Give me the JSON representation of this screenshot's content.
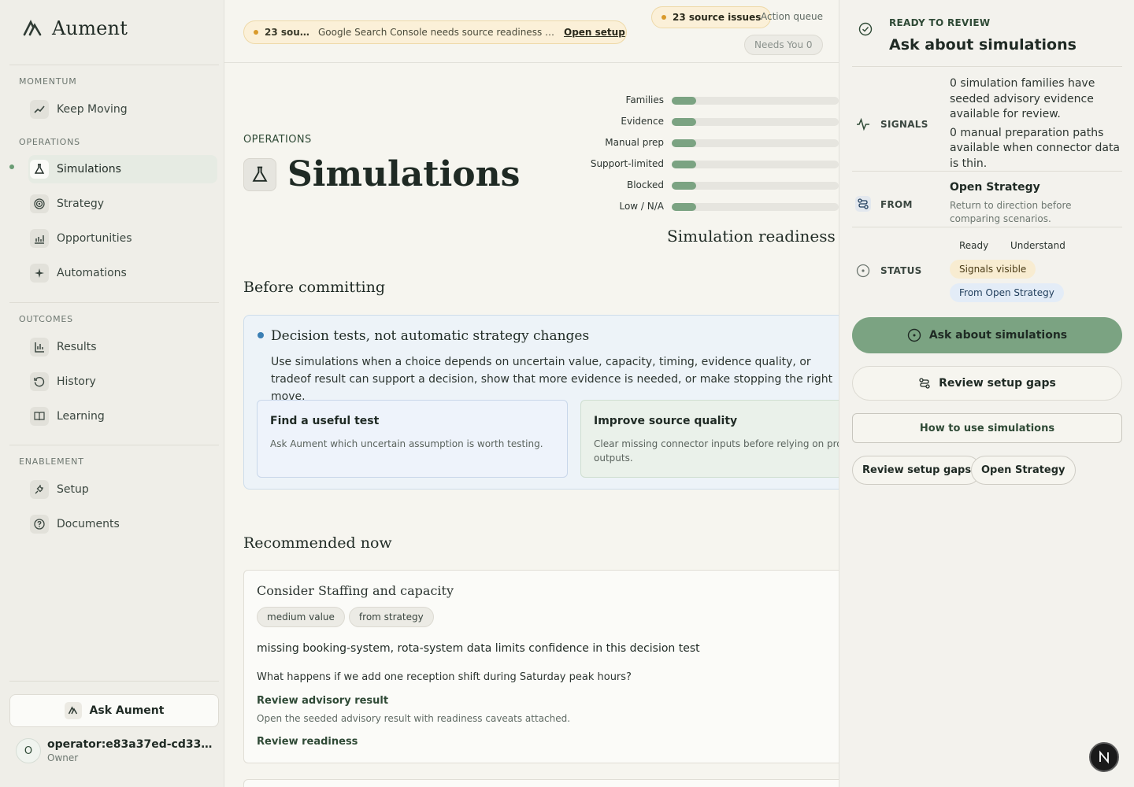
{
  "brand": {
    "name": "Aument"
  },
  "sidebar": {
    "sections": [
      "MOMENTUM",
      "OPERATIONS",
      "OUTCOMES",
      "ENABLEMENT"
    ],
    "items": [
      {
        "label": "Keep Moving",
        "icon": "trend-up-icon"
      },
      {
        "label": "Simulations",
        "icon": "flask-icon"
      },
      {
        "label": "Strategy",
        "icon": "target-icon"
      },
      {
        "label": "Opportunities",
        "icon": "chart-icon"
      },
      {
        "label": "Automations",
        "icon": "sparkle-icon"
      },
      {
        "label": "Results",
        "icon": "bars-icon"
      },
      {
        "label": "History",
        "icon": "history-icon"
      },
      {
        "label": "Learning",
        "icon": "book-icon"
      },
      {
        "label": "Setup",
        "icon": "plug-icon"
      },
      {
        "label": "Documents",
        "icon": "help-icon"
      }
    ],
    "ask_label": "Ask Aument",
    "user": {
      "initial": "O",
      "name": "operator:e83a37ed-cd33-41...",
      "role": "Owner"
    }
  },
  "topbar": {
    "alert_count": "23 sourc...",
    "alert_message": "Google Search Console needs source readiness attenti...",
    "alert_link": "Open setup",
    "issues_label": "23 source issues",
    "action_queue": "Action queue",
    "needs_you": "Needs You 0"
  },
  "page": {
    "eyebrow": "OPERATIONS",
    "title": "Simulations"
  },
  "chart_data": {
    "type": "bar",
    "title": "Simulation readiness",
    "categories": [
      "Families",
      "Evidence",
      "Manual prep",
      "Support-limited",
      "Blocked",
      "Low / N/A"
    ],
    "values": [
      0,
      0,
      0,
      0,
      0,
      0
    ]
  },
  "before": {
    "heading": "Before committing",
    "card_title": "Decision tests, not automatic strategy changes",
    "card_body": "Use simulations when a choice depends on uncertain value, capacity, timing, evidence quality, or tradeof result can support a decision, show that more evidence is needed, or make stopping the right move.",
    "sub1_title": "Find a useful test",
    "sub1_text": "Ask Aument which uncertain assumption is worth testing.",
    "sub2_title": "Improve source quality",
    "sub2_text": "Clear missing connector inputs before relying on pro outputs."
  },
  "recommended": {
    "heading": "Recommended now",
    "title": "Consider Staffing and capacity",
    "tags": [
      "medium value",
      "from strategy"
    ],
    "line1": "missing booking-system, rota-system data limits confidence in this decision test",
    "question": "What happens if we add one reception shift during Saturday peak hours?",
    "link1": "Review advisory result",
    "note": "Open the seeded advisory result with readiness caveats attached.",
    "link2": "Review readiness"
  },
  "panel": {
    "eyebrow": "READY TO REVIEW",
    "title": "Ask about simulations",
    "signals_label": "SIGNALS",
    "signals_1": "0 simulation families have seeded advisory evidence available for review.",
    "signals_2": "0 manual preparation paths available when connector data is thin.",
    "from_label": "FROM",
    "from_title": "Open Strategy",
    "from_sub": "Return to direction before comparing scenarios.",
    "status_label": "STATUS",
    "status_chips": [
      "Ready",
      "Understand",
      "Signals visible",
      "From Open Strategy"
    ],
    "primary_btn": "Ask about simulations",
    "outline_btn": "Review setup gaps",
    "rect_btn": "How to use simulations",
    "small_btn_1": "Review setup gaps",
    "small_btn_2": "Open Strategy"
  },
  "fab_label": "N",
  "colors": {
    "accent": "#7ba382",
    "amber": "#d99a2b",
    "info": "#3b7fb4"
  }
}
